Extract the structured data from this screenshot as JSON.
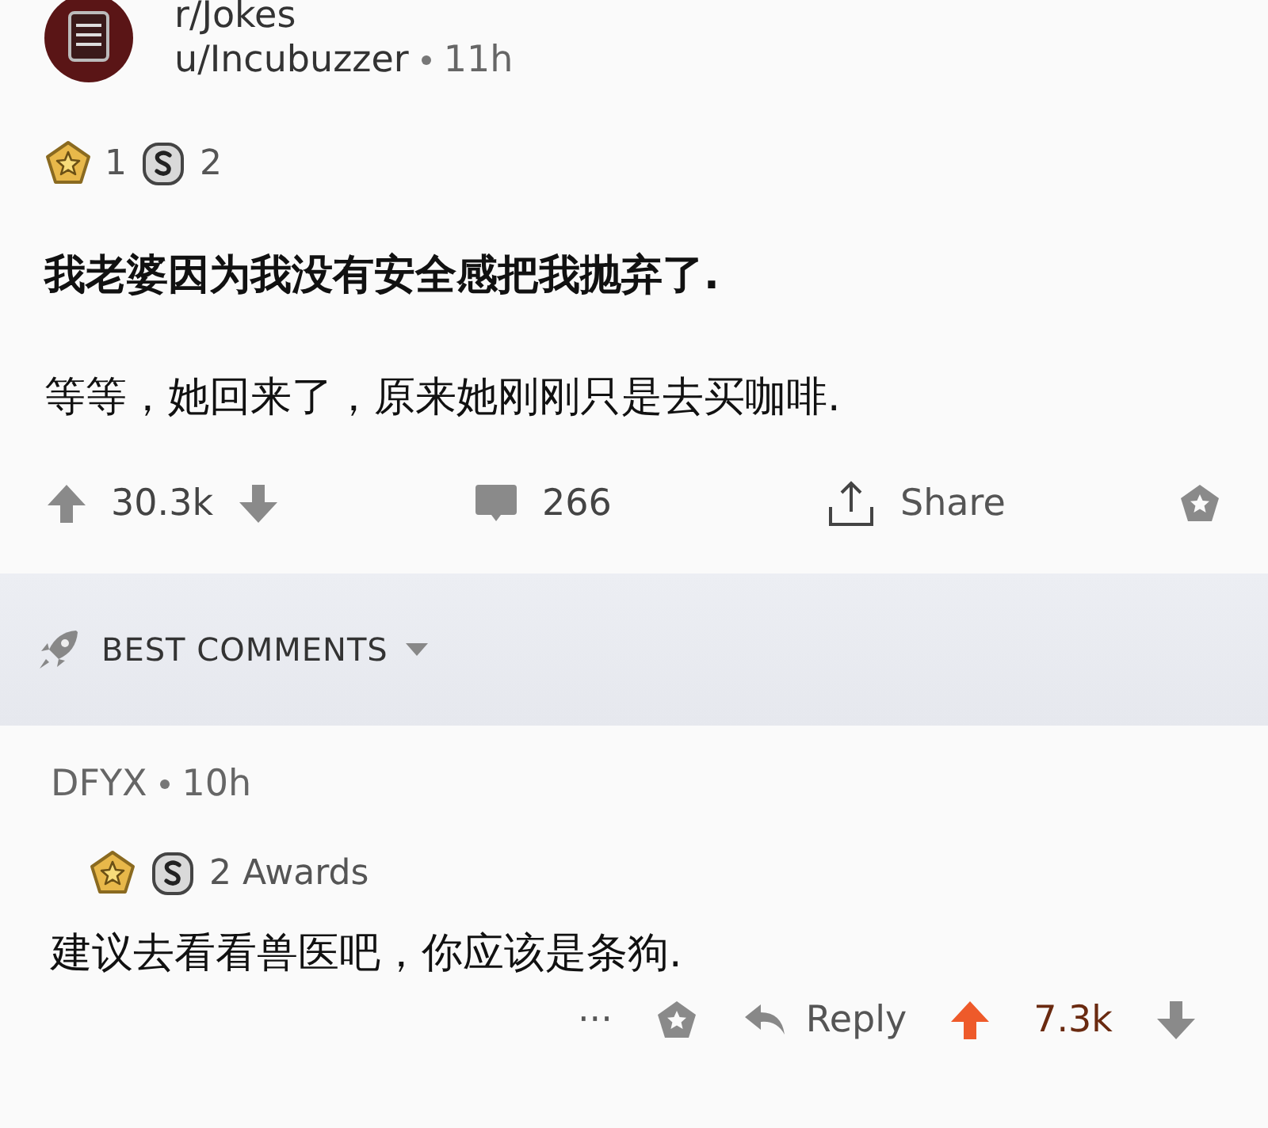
{
  "post": {
    "subreddit": "r/Jokes",
    "user": "u/Incubuzzer",
    "time": "11h",
    "awards": [
      {
        "kind": "gold",
        "count": "1"
      },
      {
        "kind": "silver",
        "count": "2"
      }
    ],
    "title": "我老婆因为我没有安全感把我抛弃了.",
    "body": "等等，她回来了，原来她刚刚只是去买咖啡.",
    "votes": "30.3k",
    "upvoted": false,
    "comments": "266",
    "share": "Share"
  },
  "sort": {
    "label": "BEST COMMENTS"
  },
  "comments": [
    {
      "author": "DFYX",
      "time": "10h",
      "awards": [
        {
          "kind": "gold"
        },
        {
          "kind": "silver"
        }
      ],
      "awards_label": "2 Awards",
      "text": "建议去看看兽医吧，你应该是条狗.",
      "more": "···",
      "reply": "Reply",
      "votes": "7.3k",
      "upvoted": true
    }
  ]
}
